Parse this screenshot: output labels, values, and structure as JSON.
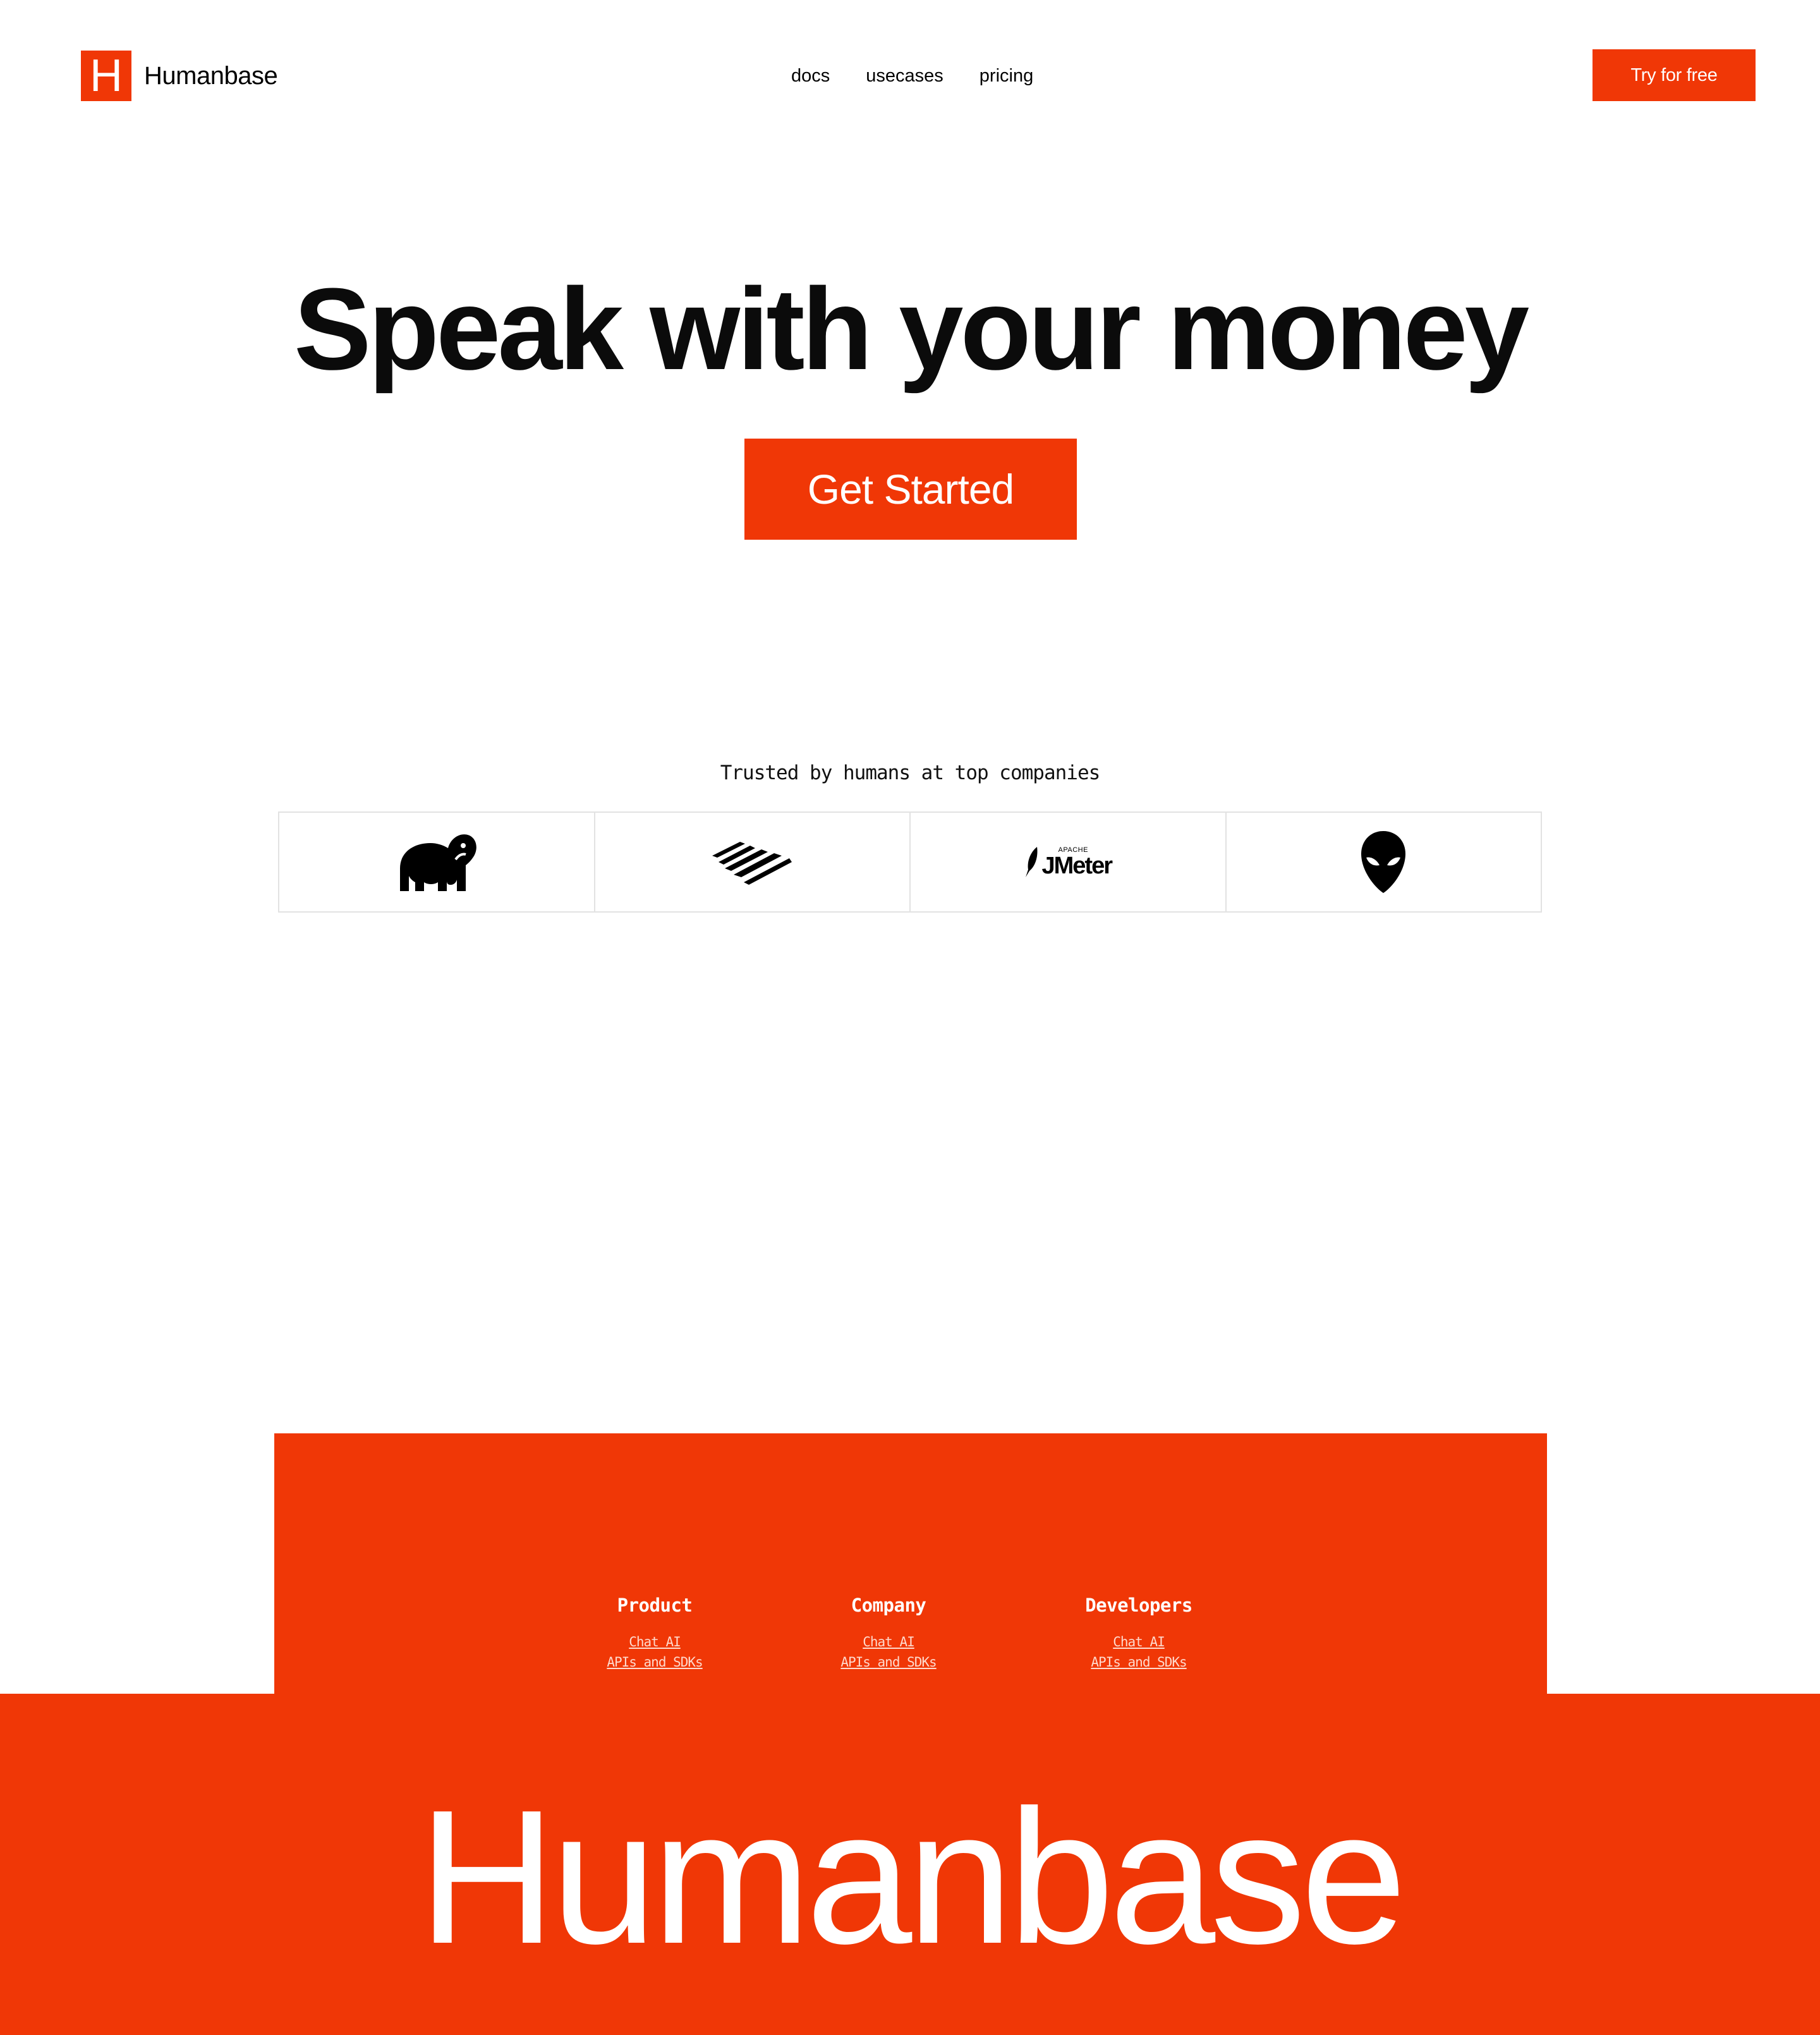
{
  "header": {
    "brand_mark": "H",
    "brand_name": "Humanbase",
    "nav": [
      {
        "label": "docs"
      },
      {
        "label": "usecases"
      },
      {
        "label": "pricing"
      }
    ],
    "cta_label": "Try for free"
  },
  "hero": {
    "title": "Speak with your money",
    "cta_label": "Get Started"
  },
  "trusted": {
    "label": "Trusted by humans at top companies",
    "logos": [
      {
        "icon": "elephant-icon"
      },
      {
        "icon": "bank-flag-icon"
      },
      {
        "icon": "jmeter-logo",
        "small_text": "APACHE",
        "text": "JMeter"
      },
      {
        "icon": "alien-head-icon"
      }
    ]
  },
  "footer": {
    "columns": [
      {
        "title": "Product",
        "links": [
          "Chat AI",
          "APIs and SDKs"
        ]
      },
      {
        "title": "Company",
        "links": [
          "Chat AI",
          "APIs and SDKs"
        ]
      },
      {
        "title": "Developers",
        "links": [
          "Chat AI",
          "APIs and SDKs"
        ]
      }
    ],
    "wordmark": "Humanbase"
  },
  "colors": {
    "accent": "#f03706",
    "background": "#ffffff",
    "text": "#000000",
    "border": "#e2e2e2"
  }
}
